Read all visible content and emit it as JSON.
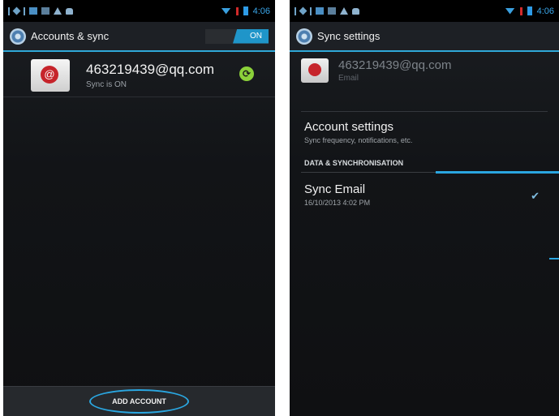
{
  "left": {
    "status": {
      "time": "4:06"
    },
    "header": {
      "title": "Accounts & sync",
      "toggle_label": "ON"
    },
    "account": {
      "email": "463219439@qq.com",
      "status": "Sync is ON"
    },
    "footer": {
      "add_account": "ADD ACCOUNT"
    }
  },
  "right": {
    "status": {
      "time": "4:06"
    },
    "header": {
      "title": "Sync settings"
    },
    "account": {
      "email": "463219439@qq.com",
      "type": "Email"
    },
    "account_settings": {
      "title": "Account settings",
      "subtitle": "Sync frequency, notifications, etc."
    },
    "section": "DATA & SYNCHRONISATION",
    "sync_email": {
      "title": "Sync Email",
      "timestamp": "16/10/2013 4:02 PM",
      "checked": true
    }
  },
  "colors": {
    "accent": "#2aa6e0",
    "toggle_on": "#1f95c9",
    "sync_green": "#8bd13a",
    "mail_red": "#c6242b"
  },
  "icons": [
    "settings-gear-icon",
    "email-icon",
    "sync-icon",
    "checkmark-icon",
    "wifi-icon",
    "battery-icon"
  ]
}
